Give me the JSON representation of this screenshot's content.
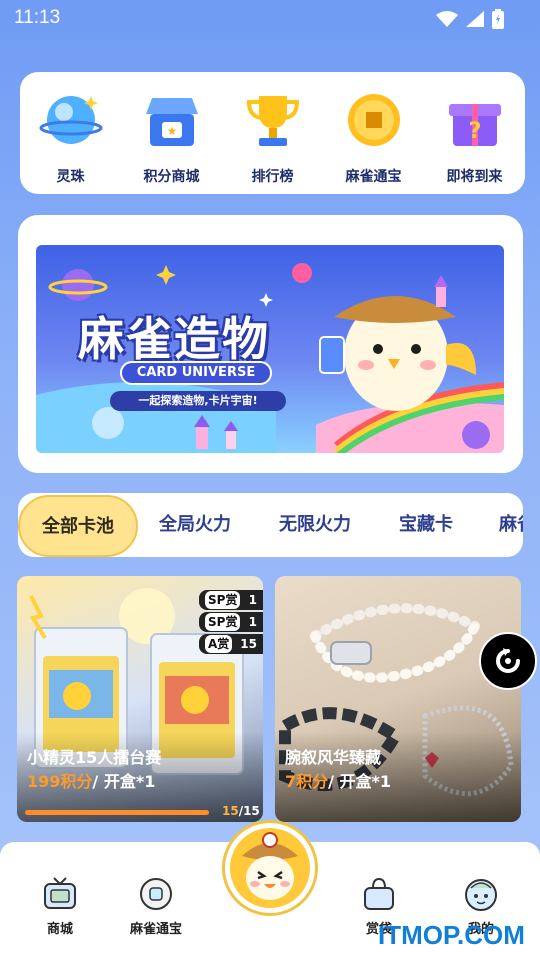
{
  "status": {
    "time": "11:13"
  },
  "quick_actions": [
    {
      "label": "灵珠",
      "icon": "orb-icon"
    },
    {
      "label": "积分商城",
      "icon": "shop-icon"
    },
    {
      "label": "排行榜",
      "icon": "trophy-icon"
    },
    {
      "label": "麻雀通宝",
      "icon": "coin-icon"
    },
    {
      "label": "即将到来",
      "icon": "mystery-box-icon"
    }
  ],
  "banner": {
    "title": "麻雀造物",
    "tagline": "CARD UNIVERSE",
    "subtitle": "一起探索造物,卡片宇宙!"
  },
  "tabs": [
    "全部卡池",
    "全局火力",
    "无限火力",
    "宝藏卡",
    "麻雀"
  ],
  "active_tab": "全部卡池",
  "pools": [
    {
      "title": "小精灵15人擂台赛",
      "points": "199积分",
      "suffix": "/ 开盒*1",
      "prizes": [
        {
          "tier": "SP赏",
          "count": "1"
        },
        {
          "tier": "SP赏",
          "count": "1"
        },
        {
          "tier": "A赏",
          "count": "15"
        }
      ],
      "progress_current": "15",
      "progress_total": "/15",
      "progress_fraction": 1.0
    },
    {
      "title": "腕叙风华臻藏",
      "points": "7积分",
      "suffix": "/ 开盒*1"
    }
  ],
  "bottom_nav": [
    {
      "label": "商城",
      "icon": "tv-icon"
    },
    {
      "label": "麻雀通宝",
      "icon": "coin-outline-icon"
    },
    {
      "label": "赏袋",
      "icon": "bag-icon"
    },
    {
      "label": "我的",
      "icon": "profile-face-icon"
    }
  ],
  "watermark": "ITMOP.COM",
  "colors": {
    "accent": "#ffe38e",
    "points": "#ff9a2b",
    "brand_blue": "#3f62e6"
  }
}
